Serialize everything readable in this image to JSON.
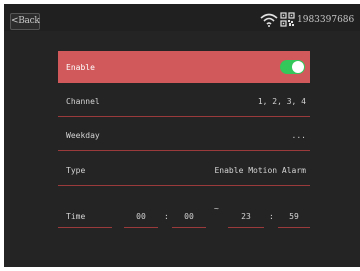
{
  "topbar": {
    "back_label": "<Back",
    "device_id": "1983397686",
    "wifi_icon": "wifi-icon",
    "qr_icon": "qr-code-icon"
  },
  "settings": {
    "enable": {
      "label": "Enable",
      "checked": true
    },
    "channel": {
      "label": "Channel",
      "value": "1, 2, 3, 4"
    },
    "weekday": {
      "label": "Weekday",
      "value": "..."
    },
    "type": {
      "label": "Type",
      "value": "Enable Motion Alarm"
    },
    "time": {
      "label": "Time",
      "start_hour": "00",
      "start_minute": "00",
      "separator": "~",
      "colon": ":",
      "end_hour": "23",
      "end_minute": "59"
    }
  },
  "colors": {
    "enable_row_bg": "#d1595b",
    "toggle_on": "#34c759",
    "divider": "#9a3a3a",
    "screen_bg": "#242424"
  }
}
